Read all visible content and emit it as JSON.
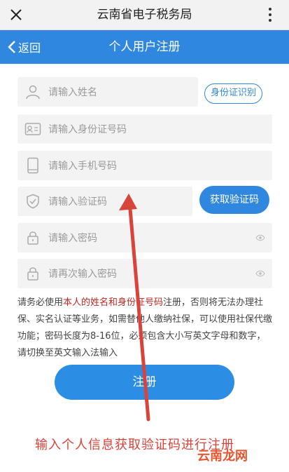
{
  "topbar": {
    "title": "云南省电子税务局"
  },
  "navbar": {
    "back_label": "返回",
    "title": "个人用户注册"
  },
  "form": {
    "name_placeholder": "请输入姓名",
    "id_recognition_label": "身份证识别",
    "id_placeholder": "请输入身份证号码",
    "phone_placeholder": "请输入手机号码",
    "code_placeholder": "请输入验证码",
    "get_code_label": "获取验证码",
    "password_placeholder": "请输入密码",
    "password_confirm_placeholder": "请再次输入密码"
  },
  "notice": {
    "prefix": "请务必使用",
    "highlight": "本人的姓名和身份证号码",
    "suffix": "注册，否则将无法办理社保、实名认证等业务，如需替他人缴纳社保，可以使用社保代缴功能；密码长度为8-16位，必须包含大小写英文字母和数字，请切换至英文输入法输入"
  },
  "register_label": "注册",
  "annotation": {
    "caption": "输入个人信息获取验证码进行注册",
    "watermark": "云南龙网"
  },
  "colors": {
    "primary": "#2f87df",
    "annotation": "#d8433a",
    "highlight": "#c0281f"
  },
  "icons": [
    "close-icon",
    "more-icon",
    "back-chevron-icon",
    "user-icon",
    "id-card-icon",
    "phone-icon",
    "shield-icon",
    "lock-icon",
    "eye-icon",
    "arrow-annotation"
  ]
}
